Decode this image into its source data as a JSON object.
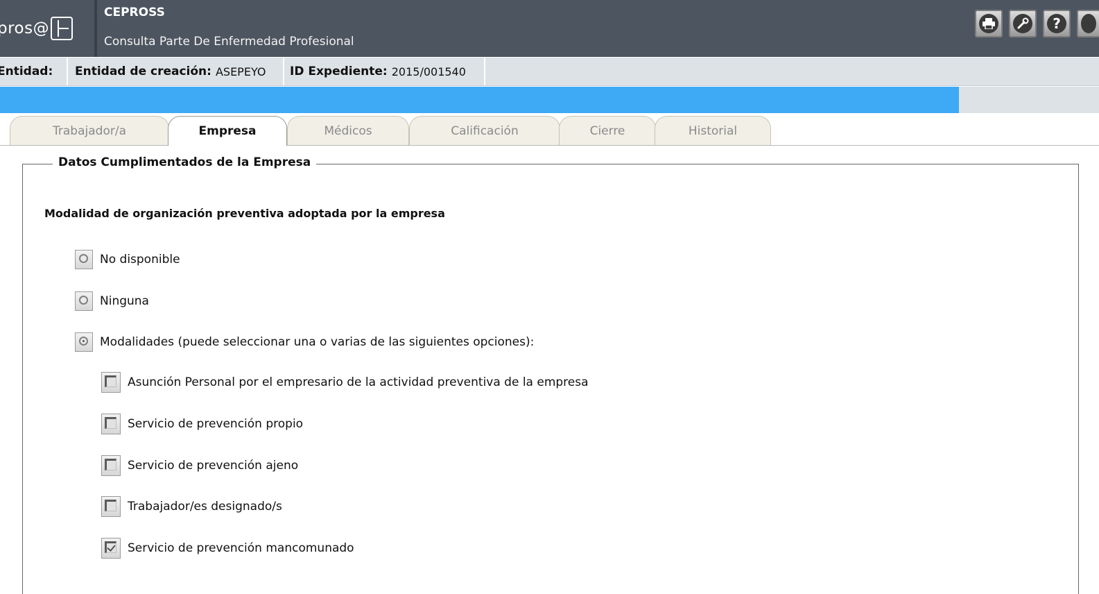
{
  "header": {
    "logo_text": "pros@",
    "app_title": "CEPROSS",
    "app_subtitle": "Consulta Parte De Enfermedad Profesional",
    "buttons": [
      {
        "name": "print-icon",
        "glyph": "⎙"
      },
      {
        "name": "tool-icon",
        "glyph": "⚒"
      },
      {
        "name": "help-icon",
        "glyph": "?"
      }
    ]
  },
  "infobar": {
    "entidad_label": "Entidad:",
    "creacion_label": "Entidad de creación:",
    "creacion_value": "ASEPEYO",
    "expediente_label": "ID Expediente:",
    "expediente_value": "2015/001540"
  },
  "tabs": [
    {
      "label": "Trabajador/a",
      "active": false
    },
    {
      "label": "Empresa",
      "active": true
    },
    {
      "label": "Médicos",
      "active": false
    },
    {
      "label": "Calificación",
      "active": false
    },
    {
      "label": "Cierre",
      "active": false
    },
    {
      "label": "Historial",
      "active": false
    }
  ],
  "form": {
    "legend": "Datos Cumplimentados de la Empresa",
    "question": "Modalidad de organización preventiva adoptada por la empresa",
    "radios": [
      {
        "label": "No disponible",
        "checked": false
      },
      {
        "label": "Ninguna",
        "checked": false
      },
      {
        "label": "Modalidades (puede seleccionar una o varias de las siguientes opciones):",
        "checked": true
      }
    ],
    "checkboxes": [
      {
        "label": "Asunción Personal por el empresario de la actividad preventiva de la empresa",
        "checked": false
      },
      {
        "label": "Servicio de prevención propio",
        "checked": false
      },
      {
        "label": "Servicio de prevención ajeno",
        "checked": false
      },
      {
        "label": "Trabajador/es designado/s",
        "checked": false
      },
      {
        "label": "Servicio de prevención mancomunado",
        "checked": true
      }
    ]
  },
  "colors": {
    "header_bg": "#4d5560",
    "blue_bar": "#3ea9f5",
    "infobar_bg": "#dde2e6"
  }
}
